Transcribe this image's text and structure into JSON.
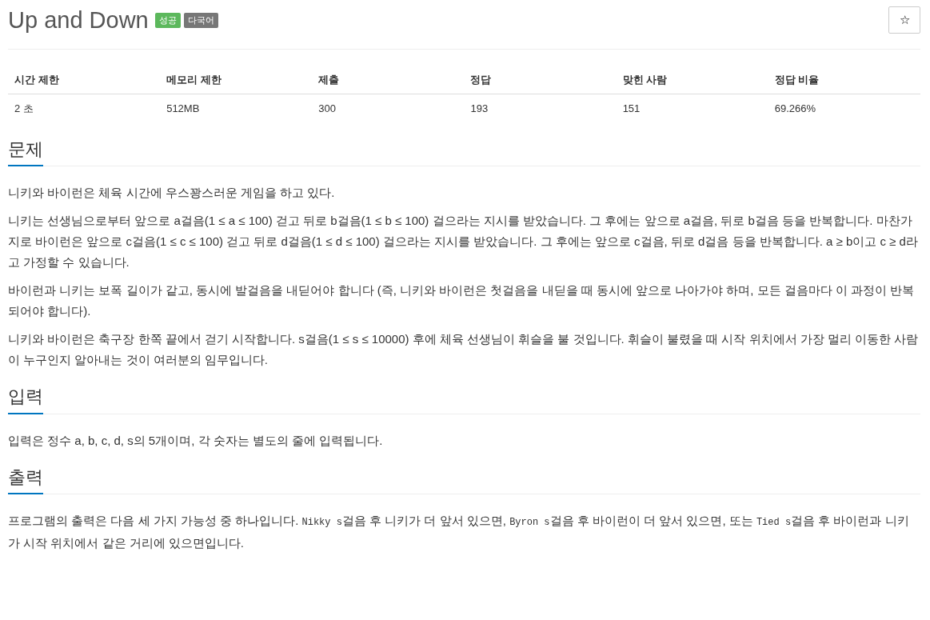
{
  "title": "Up and Down",
  "badges": [
    {
      "label": "성공",
      "kind": "success"
    },
    {
      "label": "다국어",
      "kind": "language"
    }
  ],
  "star_button": {
    "label": "☆"
  },
  "info_table": {
    "columns": [
      "시간 제한",
      "메모리 제한",
      "제출",
      "정답",
      "맞힌 사람",
      "정답 비율"
    ],
    "rows": [
      [
        "2 초",
        "512MB",
        "300",
        "193",
        "151",
        "69.266%"
      ]
    ]
  },
  "sections": [
    {
      "heading": "문제",
      "paragraphs": [
        [
          {
            "kind": "text",
            "text": "니키와 바이런은 체육 시간에 우스꽝스러운 게임을 하고 있다."
          }
        ],
        [
          {
            "kind": "text",
            "text": "니키는 선생님으로부터 앞으로 a걸음(1 ≤ a ≤ 100) 걷고 뒤로 b걸음(1 ≤ b ≤ 100) 걸으라는 지시를 받았습니다. 그 후에는 앞으로 a걸음, 뒤로 b걸음 등을 반복합니다. 마찬가지로 바이런은 앞으로 c걸음(1 ≤ c ≤ 100) 걷고 뒤로 d걸음(1 ≤ d ≤ 100) 걸으라는 지시를 받았습니다. 그 후에는 앞으로 c걸음, 뒤로 d걸음 등을 반복합니다. a ≥ b이고 c ≥ d라고 가정할 수 있습니다."
          }
        ],
        [
          {
            "kind": "text",
            "text": "바이런과 니키는 보폭 길이가 같고, 동시에 발걸음을 내딛어야 합니다 (즉, 니키와 바이런은 첫걸음을 내딛을 때 동시에 앞으로 나아가야 하며, 모든 걸음마다 이 과정이 반복되어야 합니다)."
          }
        ],
        [
          {
            "kind": "text",
            "text": "니키와 바이런은 축구장 한쪽 끝에서 걷기 시작합니다. s걸음(1 ≤ s ≤ 10000) 후에 체육 선생님이 휘슬을 불 것입니다. 휘슬이 불렸을 때 시작 위치에서 가장 멀리 이동한 사람이 누구인지 알아내는 것이 여러분의 임무입니다."
          }
        ]
      ]
    },
    {
      "heading": "입력",
      "paragraphs": [
        [
          {
            "kind": "text",
            "text": "입력은 정수 a, b, c, d, s의 5개이며, 각 숫자는 별도의 줄에 입력됩니다."
          }
        ]
      ]
    },
    {
      "heading": "출력",
      "paragraphs": [
        [
          {
            "kind": "text",
            "text": "프로그램의 출력은 다음 세 가지 가능성 중 하나입니다. "
          },
          {
            "kind": "code",
            "text": "Nikky s"
          },
          {
            "kind": "text",
            "text": "걸음 후 니키가 더 앞서 있으면, "
          },
          {
            "kind": "code",
            "text": "Byron s"
          },
          {
            "kind": "text",
            "text": "걸음 후 바이런이 더 앞서 있으면, 또는 "
          },
          {
            "kind": "code",
            "text": "Tied s"
          },
          {
            "kind": "text",
            "text": "걸음 후 바이런과 니키가 시작 위치에서 같은 거리에 있으면입니다."
          }
        ]
      ]
    }
  ]
}
